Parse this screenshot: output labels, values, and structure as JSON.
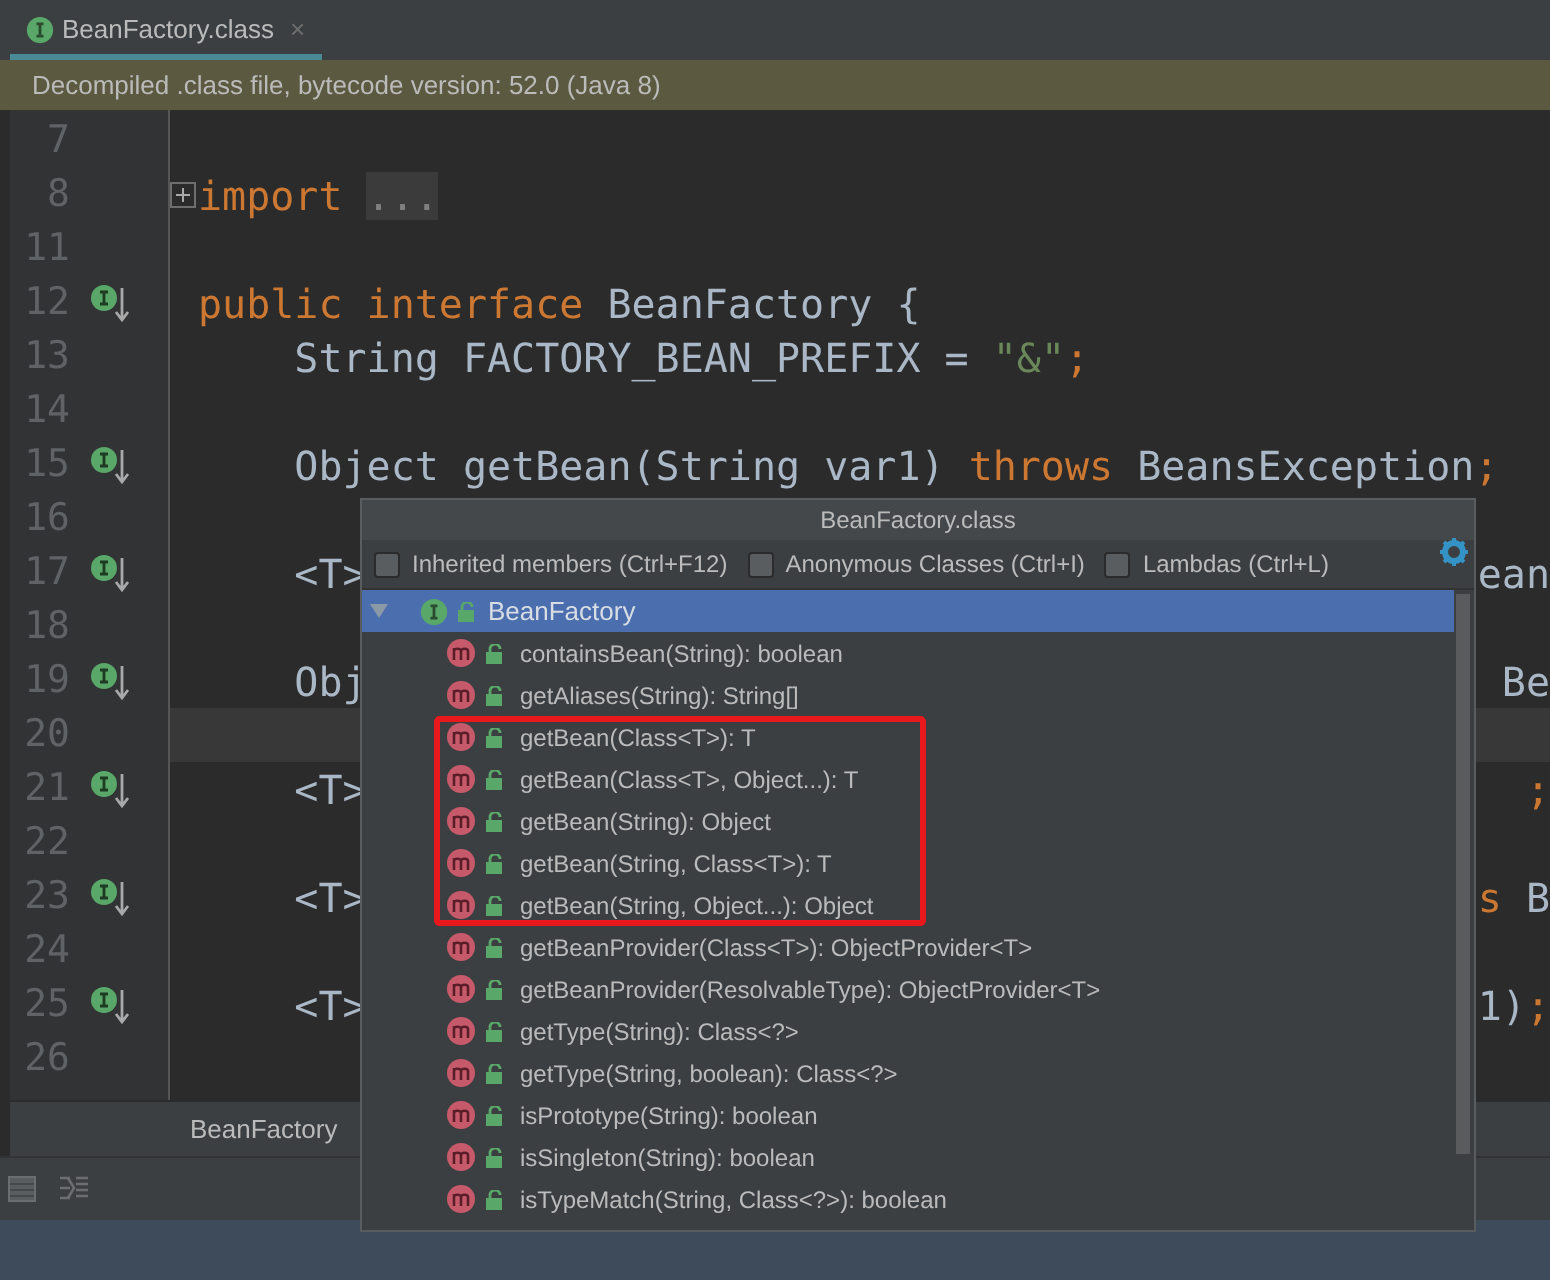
{
  "tab": {
    "title": "BeanFactory.class",
    "close": "×",
    "selected": true
  },
  "banner": "Decompiled .class file, bytecode version: 52.0 (Java 8)",
  "code_lines": [
    {
      "number": "7",
      "marker": false,
      "current": false
    },
    {
      "number": "8",
      "marker": false,
      "current": false,
      "folded": true,
      "tokens": [
        {
          "text": "import",
          "kind": "keyword"
        },
        {
          "text": "...",
          "kind": "fold"
        }
      ]
    },
    {
      "number": "11",
      "marker": false,
      "current": false
    },
    {
      "number": "12",
      "marker": true,
      "current": false,
      "tokens": [
        {
          "text": "public interface",
          "kind": "keyword"
        },
        {
          "text": " BeanFactory {",
          "kind": "plain"
        }
      ]
    },
    {
      "number": "13",
      "marker": false,
      "current": false,
      "tokens": [
        {
          "text": "    String FACTORY_BEAN_PREFIX = ",
          "kind": "plain"
        },
        {
          "text": "\"&\"",
          "kind": "string"
        },
        {
          "text": ";",
          "kind": "keyword"
        }
      ]
    },
    {
      "number": "14",
      "marker": false,
      "current": false
    },
    {
      "number": "15",
      "marker": true,
      "current": false,
      "tokens": [
        {
          "text": "    Object getBean(String var1) ",
          "kind": "plain"
        },
        {
          "text": "throws",
          "kind": "keyword"
        },
        {
          "text": " BeansException",
          "kind": "plain"
        },
        {
          "text": ";",
          "kind": "keyword"
        }
      ]
    },
    {
      "number": "16",
      "marker": false,
      "current": false
    },
    {
      "number": "17",
      "marker": true,
      "current": false,
      "tokens": [
        {
          "text": "    <T>",
          "kind": "plain"
        }
      ],
      "right_tokens": [
        {
          "text": "ean",
          "kind": "plain"
        }
      ]
    },
    {
      "number": "18",
      "marker": false,
      "current": false
    },
    {
      "number": "19",
      "marker": true,
      "current": false,
      "tokens": [
        {
          "text": "    Obj",
          "kind": "plain"
        }
      ],
      "right_tokens": [
        {
          "text": "Be",
          "kind": "plain"
        }
      ]
    },
    {
      "number": "20",
      "marker": false,
      "current": true
    },
    {
      "number": "21",
      "marker": true,
      "current": false,
      "tokens": [
        {
          "text": "    <T>",
          "kind": "plain"
        }
      ],
      "right_tokens": [
        {
          "text": ";",
          "kind": "keyword"
        }
      ]
    },
    {
      "number": "22",
      "marker": false,
      "current": false
    },
    {
      "number": "23",
      "marker": true,
      "current": false,
      "tokens": [
        {
          "text": "    <T>",
          "kind": "plain"
        }
      ],
      "right_tokens": [
        {
          "text": "s",
          "kind": "keyword"
        },
        {
          "text": " B",
          "kind": "plain"
        }
      ]
    },
    {
      "number": "24",
      "marker": false,
      "current": false
    },
    {
      "number": "25",
      "marker": true,
      "current": false,
      "tokens": [
        {
          "text": "    <T>",
          "kind": "plain"
        }
      ],
      "right_tokens": [
        {
          "text": "1)",
          "kind": "plain"
        },
        {
          "text": ";",
          "kind": "keyword"
        }
      ]
    },
    {
      "number": "26",
      "marker": false,
      "current": false
    }
  ],
  "breadcrumb": "BeanFactory",
  "structure_popup": {
    "title": "BeanFactory.class",
    "options": [
      {
        "label": "Inherited members (Ctrl+F12)",
        "checked": false
      },
      {
        "label": "Anonymous Classes (Ctrl+I)",
        "checked": false
      },
      {
        "label": "Lambdas (Ctrl+L)",
        "checked": false
      }
    ],
    "root": {
      "label": "BeanFactory",
      "expanded": true,
      "selected": true,
      "children": [
        {
          "label": "containsBean(String): boolean",
          "selected": false,
          "highlighted": false
        },
        {
          "label": "getAliases(String): String[]",
          "selected": false,
          "highlighted": false
        },
        {
          "label": "getBean(Class<T>): T",
          "selected": false,
          "highlighted": true
        },
        {
          "label": "getBean(Class<T>, Object...): T",
          "selected": false,
          "highlighted": true
        },
        {
          "label": "getBean(String): Object",
          "selected": false,
          "highlighted": true
        },
        {
          "label": "getBean(String, Class<T>): T",
          "selected": false,
          "highlighted": true
        },
        {
          "label": "getBean(String, Object...): Object",
          "selected": false,
          "highlighted": true
        },
        {
          "label": "getBeanProvider(Class<T>): ObjectProvider<T>",
          "selected": false,
          "highlighted": false
        },
        {
          "label": "getBeanProvider(ResolvableType): ObjectProvider<T>",
          "selected": false,
          "highlighted": false
        },
        {
          "label": "getType(String): Class<?>",
          "selected": false,
          "highlighted": false
        },
        {
          "label": "getType(String, boolean): Class<?>",
          "selected": false,
          "highlighted": false
        },
        {
          "label": "isPrototype(String): boolean",
          "selected": false,
          "highlighted": false
        },
        {
          "label": "isSingleton(String): boolean",
          "selected": false,
          "highlighted": false
        },
        {
          "label": "isTypeMatch(String, Class<?>): boolean",
          "selected": false,
          "highlighted": false
        }
      ]
    }
  }
}
